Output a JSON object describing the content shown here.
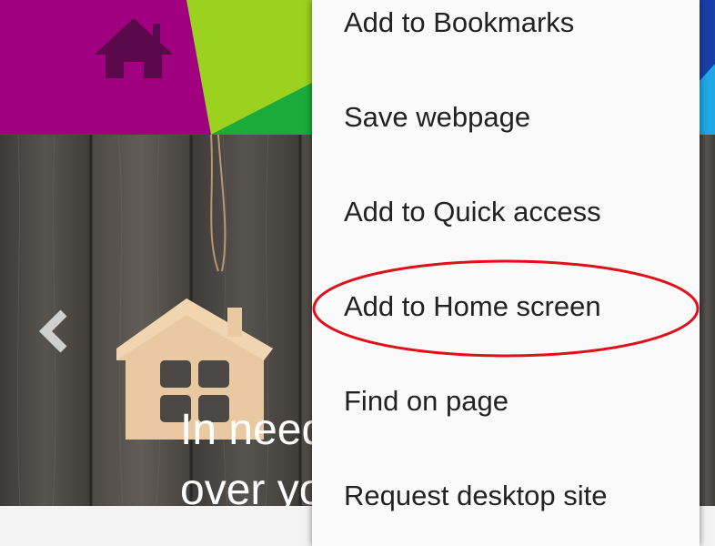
{
  "hero": {
    "title_line1": "In need",
    "title_line2": "over yo"
  },
  "menu": {
    "items": [
      {
        "label": "Add to Bookmarks"
      },
      {
        "label": "Save webpage"
      },
      {
        "label": "Add to Quick access"
      },
      {
        "label": "Add to Home screen",
        "highlighted": true
      },
      {
        "label": "Find on page"
      },
      {
        "label": "Request desktop site"
      }
    ]
  },
  "colors": {
    "header_magenta": "#a0007f",
    "header_lime": "#9bd21f",
    "header_green": "#1aab3a",
    "header_blue": "#1a3ea8",
    "header_cyan": "#1fa7e6",
    "logo_house": "#5a0a4a",
    "menu_background": "#fafafa",
    "menu_text": "#222222",
    "annotation_ring": "#e0101a"
  },
  "icons": {
    "logo": "house-icon",
    "carousel_prev": "chevron-left-icon",
    "hero_decoration": "wooden-house-illustration"
  }
}
